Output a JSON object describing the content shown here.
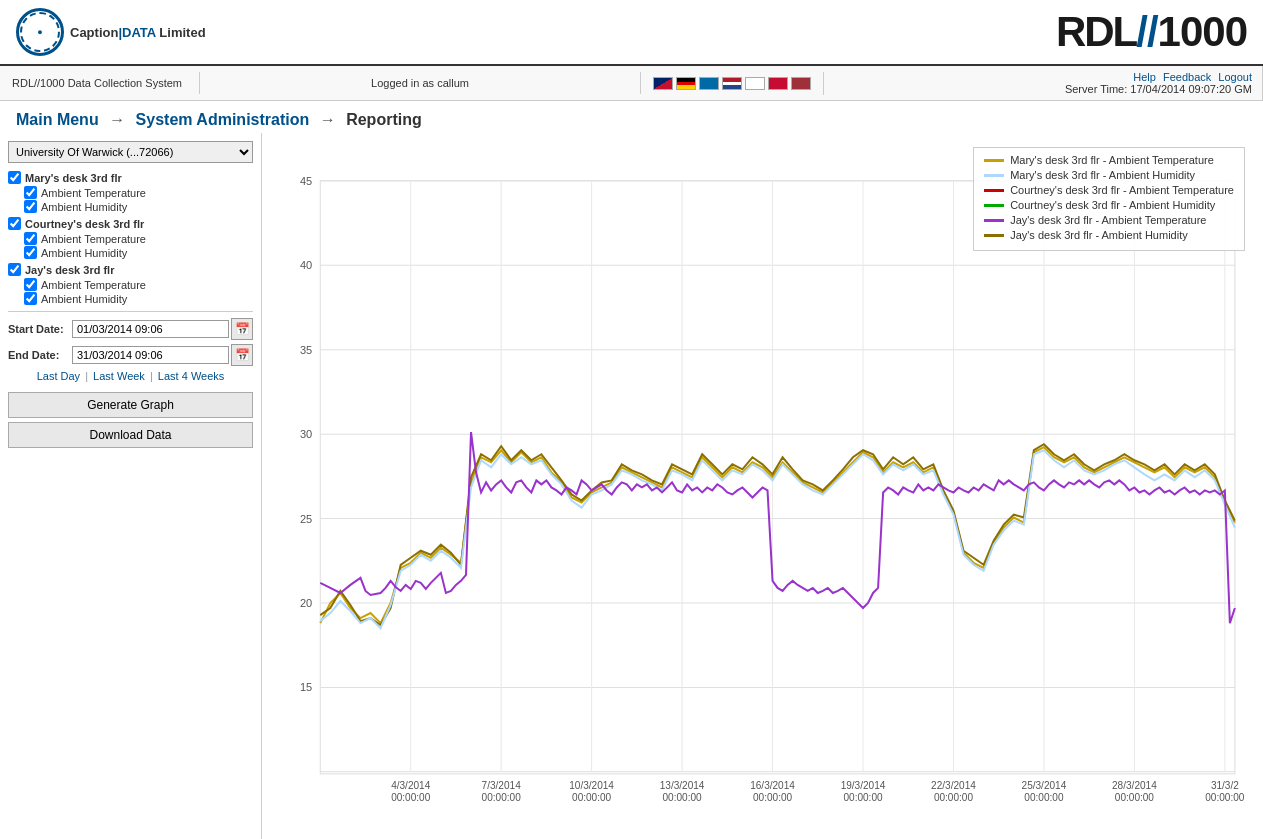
{
  "header": {
    "logo_company": "Caption DATA Limited",
    "logo_brand": "RDL//1000",
    "rdl_text": "RDL//",
    "rdl_number": "1000"
  },
  "navbar": {
    "system_label": "RDL//1000 Data Collection System",
    "logged_in_label": "Logged in as callum",
    "server_time_label": "Server Time: 17/04/2014 09:07:20 GM",
    "help_link": "Help",
    "feedback_link": "Feedback",
    "logout_link": "Logout"
  },
  "breadcrumb": {
    "main_menu": "Main Menu",
    "system_admin": "System Administration",
    "current": "Reporting",
    "sep": "→"
  },
  "sidebar": {
    "location_options": [
      "University Of Warwick (...72066)"
    ],
    "location_selected": "University Of Warwick (...72066)",
    "groups": [
      {
        "id": "mary",
        "label": "Mary's desk 3rd flr",
        "checked": true,
        "sensors": [
          {
            "label": "Ambient Temperature",
            "checked": true
          },
          {
            "label": "Ambient Humidity",
            "checked": true
          }
        ]
      },
      {
        "id": "courtney",
        "label": "Courtney's desk 3rd flr",
        "checked": true,
        "sensors": [
          {
            "label": "Ambient Temperature",
            "checked": true
          },
          {
            "label": "Ambient Humidity",
            "checked": true
          }
        ]
      },
      {
        "id": "jay",
        "label": "Jay's desk 3rd flr",
        "checked": true,
        "sensors": [
          {
            "label": "Ambient Temperature",
            "checked": true
          },
          {
            "label": "Ambient Humidity",
            "checked": true
          }
        ]
      }
    ],
    "start_date_label": "Start Date:",
    "start_date_value": "01/03/2014 09:06",
    "end_date_label": "End Date:",
    "end_date_value": "31/03/2014 09:06",
    "quick_links": {
      "last_day": "Last Day",
      "last_week": "Last Week",
      "last_4_weeks": "Last 4 Weeks"
    },
    "generate_btn": "Generate Graph",
    "download_btn": "Download Data"
  },
  "legend": {
    "items": [
      {
        "label": "Mary's desk 3rd flr - Ambient Temperature",
        "color": "#c8a000"
      },
      {
        "label": "Mary's desk 3rd flr - Ambient Humidity",
        "color": "#add8ff"
      },
      {
        "label": "Courtney's desk 3rd flr - Ambient Temperature",
        "color": "#cc0000"
      },
      {
        "label": "Courtney's desk 3rd flr - Ambient Humidity",
        "color": "#00aa00"
      },
      {
        "label": "Jay's desk 3rd flr - Ambient Temperature",
        "color": "#9933cc"
      },
      {
        "label": "Jay's desk 3rd flr - Ambient Humidity",
        "color": "#8b7000"
      }
    ]
  },
  "chart": {
    "y_axis_labels": [
      "45",
      "40",
      "35",
      "30",
      "25",
      "20",
      "15"
    ],
    "x_axis_labels": [
      "4/3/2014\n00:00:00",
      "7/3/2014\n00:00:00",
      "10/3/2014\n00:00:00",
      "13/3/2014\n00:00:00",
      "16/3/2014\n00:00:00",
      "19/3/2014\n00:00:00",
      "22/3/2014\n00:00:00",
      "25/3/2014\n00:00:00",
      "28/3/2014\n00:00:00",
      "31/3/2\n00:00:00"
    ]
  }
}
